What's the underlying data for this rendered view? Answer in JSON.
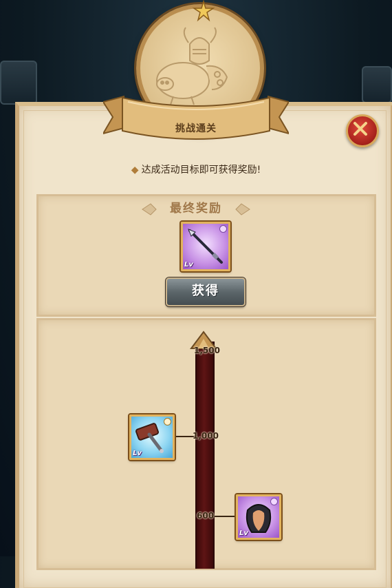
{
  "header": {
    "title": "挑战通关"
  },
  "hint": "达成活动目标即可获得奖励!",
  "final_reward": {
    "title": "最终奖励",
    "item": {
      "icon": "spear-icon",
      "level": "Lv"
    },
    "button_label": "获得"
  },
  "milestones": [
    {
      "value": "1,500"
    },
    {
      "value": "1,000",
      "item": {
        "icon": "hammer-icon",
        "level": "Lv"
      }
    },
    {
      "value": "600",
      "item": {
        "icon": "hair-icon",
        "level": "Lv"
      }
    }
  ],
  "colors": {
    "parchment": "#f0e4cb",
    "track": "#5e1414",
    "close_button": "#c62a22",
    "button_gray": "#5c666a"
  }
}
